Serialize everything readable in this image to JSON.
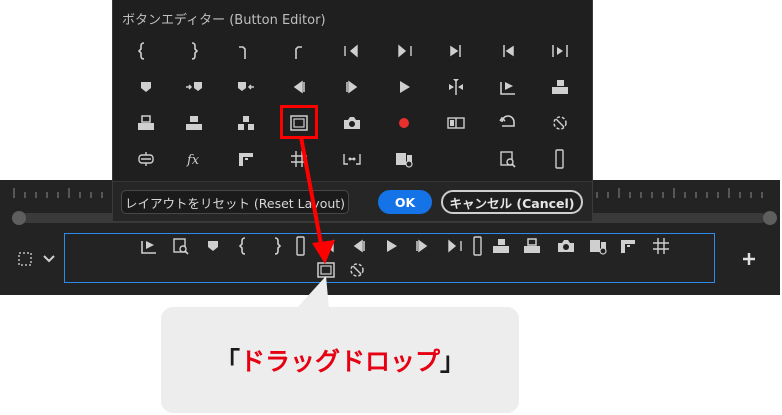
{
  "dialog": {
    "title": "ボタンエディター (Button Editor)",
    "reset_label": "レイアウトをリセット (Reset Layout)",
    "ok_label": "OK",
    "cancel_label": "キャンセル (Cancel)"
  },
  "callout": {
    "open_bracket": "「",
    "text": "ドラッグドロップ",
    "close_bracket": "」"
  },
  "colors": {
    "accent_blue": "#1473e6",
    "highlight_red": "#ff0000",
    "callout_text_red": "#e60012",
    "record_red": "#e8312d"
  },
  "dialog_icons": [
    "mark-in-icon",
    "mark-out-icon",
    "clear-in-icon",
    "clear-out-icon",
    "go-to-in-icon",
    "go-to-out-icon",
    "step-forward-frame-icon",
    "step-back-frame-icon",
    "play-in-to-out-icon",
    "add-marker-icon",
    "go-to-next-marker-icon",
    "go-to-previous-marker-icon",
    "step-back-icon",
    "step-forward-icon",
    "play-icon",
    "shuttle-icon",
    "export-frame-icon",
    "insert-icon",
    "overwrite-icon",
    "lift-icon",
    "extract-icon",
    "safe-margins-icon",
    "camera-icon",
    "record-icon",
    "comparison-view-icon",
    "loop-icon",
    "vr-video-icon",
    "proxy-toggle-icon",
    "fx-icon",
    "multi-camera-icon",
    "grid-icon",
    "trim-icon",
    "transmit-icon",
    "",
    "zoom-icon",
    "frame-icon"
  ],
  "bar_icons_row1": [
    "export-frame-icon",
    "zoom-icon",
    "add-marker-icon",
    "mark-in-icon",
    "mark-out-icon",
    "frame-icon",
    "go-to-in-icon",
    "step-back-icon",
    "play-icon",
    "step-forward-icon",
    "go-to-out-icon",
    "frame-icon",
    "insert-icon",
    "overwrite-icon",
    "camera-icon",
    "transmit-icon",
    "multi-camera-icon",
    "grid-icon"
  ],
  "bar_icons_row2": [
    "safe-margins-icon",
    "vr-video-icon"
  ]
}
